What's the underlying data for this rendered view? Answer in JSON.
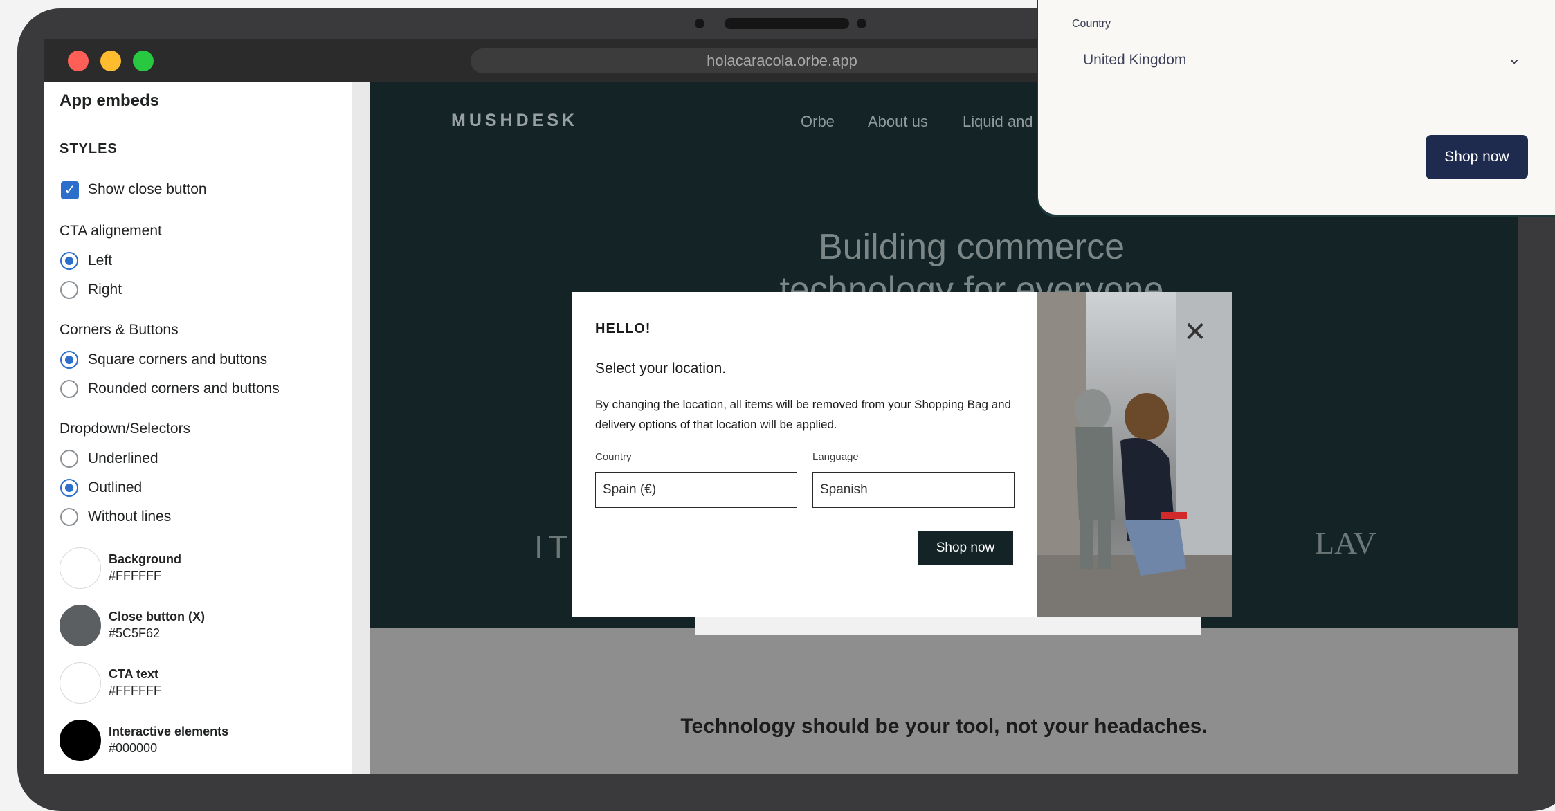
{
  "browser": {
    "url": "holacaracola.orbe.app",
    "traffic_colors": [
      "#ff5f57",
      "#febc2e",
      "#28c840"
    ]
  },
  "panel": {
    "title": "App embeds",
    "styles_heading": "STYLES",
    "show_close": {
      "label": "Show close button",
      "checked": true
    },
    "cta_alignment": {
      "heading": "CTA alignement",
      "options": [
        "Left",
        "Right"
      ],
      "selected": "Left"
    },
    "corners": {
      "heading": "Corners & Buttons",
      "options": [
        "Square corners and buttons",
        "Rounded corners and buttons"
      ],
      "selected": "Square corners and buttons"
    },
    "dropdowns": {
      "heading": "Dropdown/Selectors",
      "options": [
        "Underlined",
        "Outlined",
        "Without lines"
      ],
      "selected": "Outlined"
    },
    "swatches": [
      {
        "name": "Background",
        "hex": "#FFFFFF"
      },
      {
        "name": "Close button (X)",
        "hex": "#5C5F62"
      },
      {
        "name": "CTA text",
        "hex": "#FFFFFF"
      },
      {
        "name": "Interactive elements",
        "hex": "#000000"
      }
    ]
  },
  "site": {
    "logo": "MUSHDESK",
    "nav": [
      "Orbe",
      "About us",
      "Liquid and"
    ],
    "hero_title_1": "Building commerce",
    "hero_title_2": "technology for everyone",
    "brand_left": "ITT",
    "brand_right": "LAV",
    "tagline": "Technology should be your tool, not your headaches."
  },
  "modal": {
    "hello": "HELLO!",
    "subtitle": "Select your location.",
    "description": "By changing the location, all items will be removed from your Shopping Bag and delivery options of that location will be applied.",
    "country_label": "Country",
    "country_value": "Spain (€)",
    "language_label": "Language",
    "language_value": "Spanish",
    "cta": "Shop now"
  },
  "card": {
    "country_label": "Country",
    "country_value": "United Kingdom",
    "cta": "Shop now"
  },
  "colors": {
    "accent": "#2c6ecb",
    "site_dark": "#142325",
    "card_button": "#1f2a4f"
  }
}
